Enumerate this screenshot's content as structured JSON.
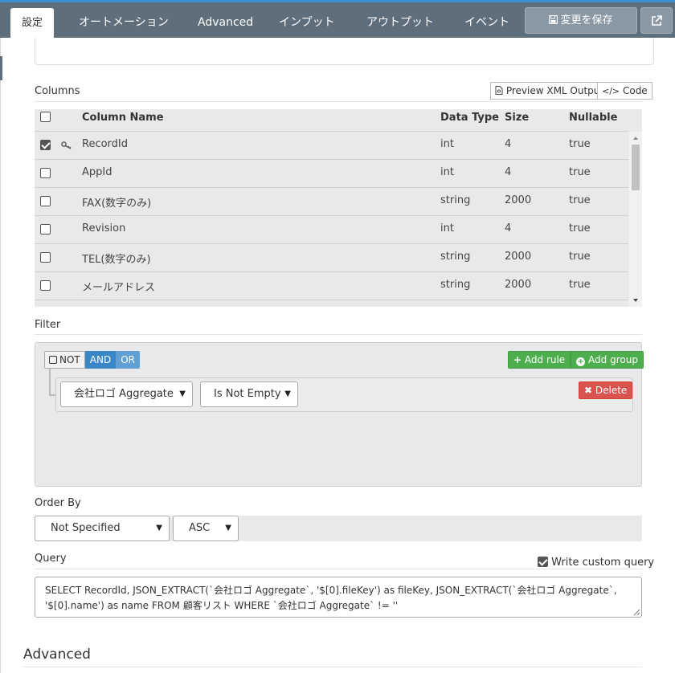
{
  "tabs": [
    {
      "label": "設定",
      "active": true
    },
    {
      "label": "オートメーション"
    },
    {
      "label": "Advanced"
    },
    {
      "label": "インプット"
    },
    {
      "label": "アウトプット"
    },
    {
      "label": "イベント"
    }
  ],
  "toolbar": {
    "save_label": "変更を保存",
    "save_icon": "floppy-disk-icon",
    "open_icon": "external-link-icon"
  },
  "columns_section": {
    "title": "Columns",
    "preview_button": "Preview XML Output",
    "code_button": "Code",
    "headers": {
      "name": "Column Name",
      "type": "Data Type",
      "size": "Size",
      "nullable": "Nullable"
    },
    "rows": [
      {
        "checked": true,
        "key": true,
        "name": "RecordId",
        "type": "int",
        "size": "4",
        "nullable": "true"
      },
      {
        "checked": false,
        "key": false,
        "name": "AppId",
        "type": "int",
        "size": "4",
        "nullable": "true"
      },
      {
        "checked": false,
        "key": false,
        "name": "FAX(数字のみ)",
        "type": "string",
        "size": "2000",
        "nullable": "true"
      },
      {
        "checked": false,
        "key": false,
        "name": "Revision",
        "type": "int",
        "size": "4",
        "nullable": "true"
      },
      {
        "checked": false,
        "key": false,
        "name": "TEL(数字のみ)",
        "type": "string",
        "size": "2000",
        "nullable": "true"
      },
      {
        "checked": false,
        "key": false,
        "name": "メールアドレス",
        "type": "string",
        "size": "2000",
        "nullable": "true"
      }
    ]
  },
  "filter": {
    "title": "Filter",
    "not_label": "NOT",
    "and_label": "AND",
    "or_label": "OR",
    "add_rule": "Add rule",
    "add_group": "Add group",
    "delete": "Delete",
    "rule_field": "会社ロゴ Aggregate",
    "rule_operator": "Is Not Empty"
  },
  "order_by": {
    "title": "Order By",
    "field": "Not Specified",
    "direction": "ASC"
  },
  "query": {
    "title": "Query",
    "custom_label": "Write custom query",
    "custom_checked": true,
    "text": "SELECT RecordId, JSON_EXTRACT(`会社ロゴ Aggregate`, '$[0].fileKey') as fileKey, JSON_EXTRACT(`会社ロゴ Aggregate`,\n'$[0].name') as name FROM 顧客リスト WHERE `会社ロゴ Aggregate` != ''"
  },
  "advanced": {
    "title": "Advanced"
  },
  "colors": {
    "topbar": "#5e6e7b",
    "and": "#3a87c8",
    "green": "#4cae4c",
    "red": "#d9534f"
  }
}
